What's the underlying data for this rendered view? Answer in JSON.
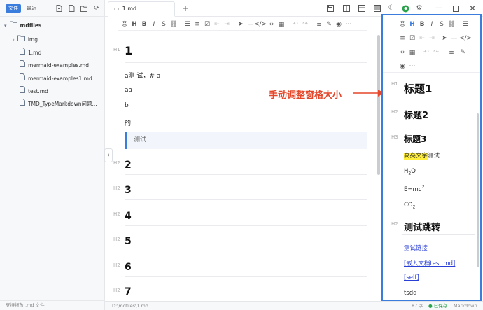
{
  "sidebar": {
    "tabs": {
      "files": "文件",
      "recent": "最近"
    },
    "root": "mdfiles",
    "items": [
      {
        "label": "img",
        "type": "folder"
      },
      {
        "label": "1.md",
        "type": "file"
      },
      {
        "label": "mermaid-examples.md",
        "type": "file"
      },
      {
        "label": "mermaid-examples1.md",
        "type": "file"
      },
      {
        "label": "test.md",
        "type": "file"
      },
      {
        "label": "TMD_TypeMarkdown问题...",
        "type": "file"
      }
    ],
    "footer": "支持拖放 .md 文件"
  },
  "tab": {
    "title": "1.md",
    "add": "+"
  },
  "toolbar": {
    "heading": "H",
    "bold": "B",
    "italic": "I",
    "strike": "S"
  },
  "editor": {
    "blocks": {
      "h1_label": "H1",
      "h1": "1",
      "para1": "a测 试，# a",
      "para2": "aa",
      "para3": "b",
      "para4": "的",
      "quote": "测试",
      "h2_label": "H2",
      "h2_items": [
        "2",
        "3",
        "4",
        "5",
        "6",
        "7"
      ]
    }
  },
  "annotation": {
    "text": "手动调整窗格大小",
    "color": "#e5472a"
  },
  "preview": {
    "h1_label": "H1",
    "h1": "标题1",
    "h2_label": "H2",
    "h2": "标题2",
    "h3_label": "H3",
    "h3": "标题3",
    "highlight": "高亮文字",
    "highlight_rest": "测试",
    "h2o_a": "H",
    "h2o_sub": "2",
    "h2o_b": "O",
    "emc_a": "E=mc",
    "emc_sup": "2",
    "co2_a": "CO",
    "co2_sub": "2",
    "h2b_label": "H2",
    "h2b": "测试跳转",
    "link1": "测试链接",
    "link2": "[嵌入文档test.md]",
    "link3": "[self]",
    "tail": "tsdd"
  },
  "status": {
    "path": "D:\\mdfiles\\1.md",
    "words": "87 字",
    "saved": "● 已保存",
    "mode": "Markdown"
  },
  "colors": {
    "accent": "#3b7ddd",
    "saved": "#2ba24c",
    "highlight": "#ffef3a"
  }
}
